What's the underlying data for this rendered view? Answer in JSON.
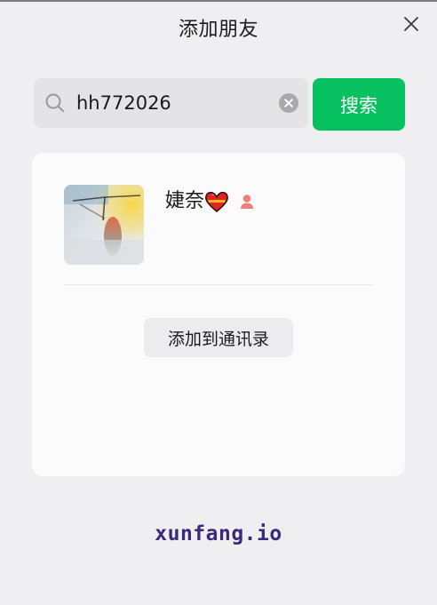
{
  "window": {
    "title": "添加朋友"
  },
  "search": {
    "value": "hh772026",
    "button_label": "搜索"
  },
  "result": {
    "name": "婕奈",
    "gender": "female",
    "add_button_label": "添加到通讯录"
  },
  "watermark": {
    "text": "xunfang.io"
  },
  "colors": {
    "accent": "#07c160",
    "gender_female": "#f07c7c",
    "watermark": "#3a2a7a"
  },
  "icons": {
    "close": "close-icon",
    "search": "search-icon",
    "clear": "clear-icon",
    "heart": "heart-icon",
    "gender": "female-user-icon"
  }
}
